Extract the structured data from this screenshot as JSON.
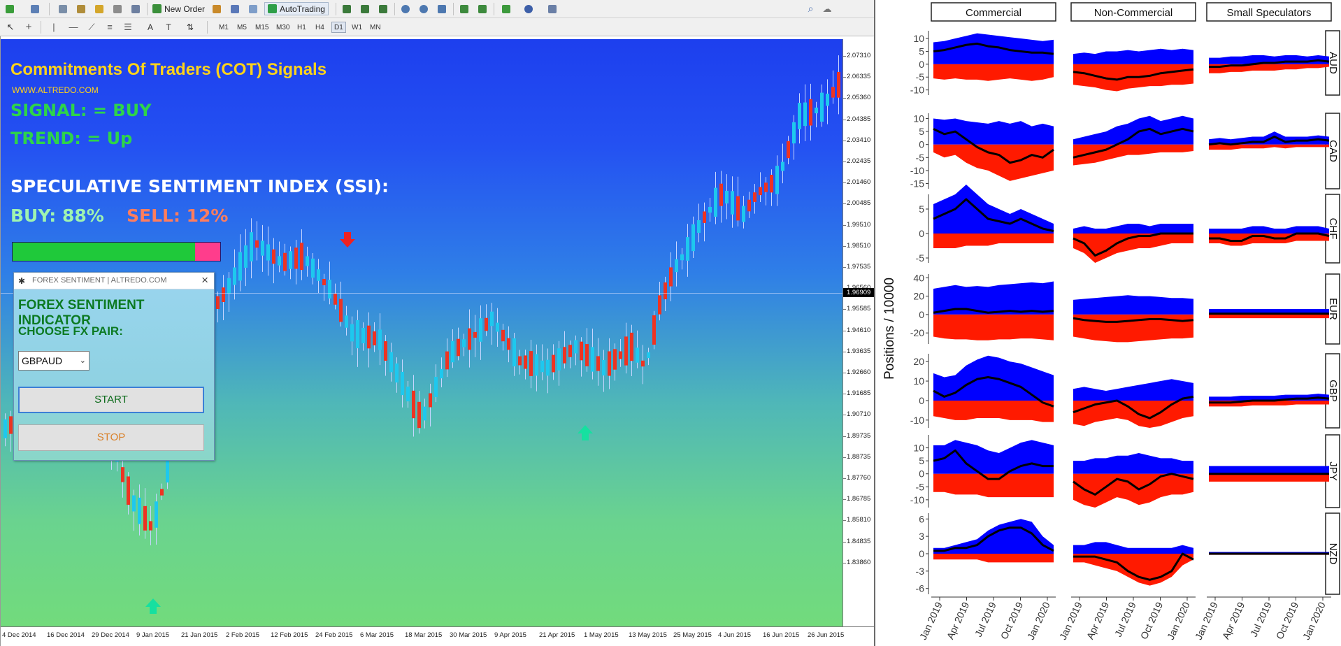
{
  "toolbar": {
    "new_order_label": "New Order",
    "autotrading_label": "AutoTrading",
    "timeframes": [
      "M1",
      "M5",
      "M15",
      "M30",
      "H1",
      "H4",
      "D1",
      "W1",
      "MN"
    ],
    "active_timeframe": "D1"
  },
  "overlay": {
    "title": "Commitments Of Traders (COT) Signals",
    "url": "WWW.ALTREDO.COM",
    "signal": "SIGNAL:  = BUY",
    "trend": "TREND: = Up",
    "ssi_title": "SPECULATIVE SENTIMENT INDEX (SSI):",
    "buy_label": "BUY: 88%",
    "sell_label": "SELL: 12%",
    "buy_pct": 88,
    "sell_pct": 12,
    "colors": {
      "title": "#ffd31a",
      "signal": "#2ed44a",
      "buy_bar": "#1fc93a",
      "sell_bar": "#ff3d8c"
    }
  },
  "dialog": {
    "title": "FOREX SENTIMENT | ALTREDO.COM",
    "heading": "FOREX SENTIMENT INDICATOR",
    "choose_label": "CHOOSE FX PAIR:",
    "pair_value": "GBPAUD",
    "start_label": "START",
    "stop_label": "STOP"
  },
  "price_axis": {
    "labels": [
      "2.07310",
      "2.06335",
      "2.05360",
      "2.04385",
      "2.03410",
      "2.02435",
      "2.01460",
      "2.00485",
      "1.99510",
      "1.98510",
      "1.97535",
      "1.96560",
      "1.95585",
      "1.94610",
      "1.93635",
      "1.92660",
      "1.91685",
      "1.90710",
      "1.89735",
      "1.88735",
      "1.87760",
      "1.86785",
      "1.85810",
      "1.84835",
      "1.83860"
    ],
    "current": "1.96909"
  },
  "time_axis": {
    "labels": [
      "4 Dec 2014",
      "16 Dec 2014",
      "29 Dec 2014",
      "9 Jan 2015",
      "21 Jan 2015",
      "2 Feb 2015",
      "12 Feb 2015",
      "24 Feb 2015",
      "6 Mar 2015",
      "18 Mar 2015",
      "30 Mar 2015",
      "9 Apr 2015",
      "21 Apr 2015",
      "1 May 2015",
      "13 May 2015",
      "25 May 2015",
      "4 Jun 2015",
      "16 Jun 2015",
      "26 Jun 2015"
    ]
  },
  "chart_data": {
    "type": "area",
    "ylabel": "Positions / 10000",
    "columns": [
      "Commercial",
      "Non-Commercial",
      "Small Speculators"
    ],
    "rows": [
      "AUD",
      "CAD",
      "CHF",
      "EUR",
      "GBP",
      "JPY",
      "NZD"
    ],
    "x_labels": [
      "Jan 2019",
      "Apr 2019",
      "Jul 2019",
      "Oct 2019",
      "Jan 2020"
    ],
    "y_ticks": {
      "AUD": [
        10,
        5,
        0,
        -5,
        -10
      ],
      "CAD": [
        10,
        5,
        0,
        -5,
        -10,
        -15
      ],
      "CHF": [
        5,
        0,
        -5
      ],
      "EUR": [
        40,
        20,
        0,
        -20
      ],
      "GBP": [
        20,
        10,
        0,
        -10
      ],
      "JPY": [
        10,
        5,
        0,
        -5,
        -10
      ],
      "NZD": [
        6,
        3,
        0,
        -3,
        -6
      ]
    },
    "ylim": {
      "AUD": [
        -12,
        13
      ],
      "CAD": [
        -17,
        12
      ],
      "CHF": [
        -6,
        8
      ],
      "EUR": [
        -32,
        44
      ],
      "GBP": [
        -14,
        24
      ],
      "JPY": [
        -13,
        15
      ],
      "NZD": [
        -7,
        7
      ]
    },
    "series_colors": {
      "long": "#0000ff",
      "short": "#ff1a00",
      "net": "#000000"
    },
    "panels": {
      "AUD": {
        "Commercial": {
          "long": [
            8.5,
            9,
            10,
            11,
            12,
            11.5,
            11,
            10.5,
            10,
            9.5,
            9,
            9.5
          ],
          "short": [
            -5.5,
            -6,
            -5.5,
            -6,
            -6,
            -6.5,
            -6,
            -5.5,
            -6,
            -6.5,
            -6,
            -5
          ],
          "net": [
            5,
            5.5,
            6.5,
            7.5,
            8,
            7,
            6.5,
            5.5,
            5,
            4.5,
            4.5,
            4
          ]
        },
        "Non-Commercial": {
          "long": [
            4,
            4.5,
            4,
            5,
            5,
            5.5,
            5,
            5.5,
            6,
            5.5,
            6,
            5.5
          ],
          "short": [
            -8,
            -8.5,
            -9,
            -10,
            -10.5,
            -9.5,
            -9,
            -8.5,
            -8.5,
            -8,
            -8,
            -7.5
          ],
          "net": [
            -3,
            -3.5,
            -4.5,
            -5.5,
            -6,
            -5,
            -5,
            -4.5,
            -3.5,
            -3,
            -2.5,
            -2
          ]
        },
        "Small Speculators": {
          "long": [
            2.5,
            2.5,
            3,
            3,
            3.5,
            3.5,
            3,
            3.5,
            3.5,
            3,
            3.5,
            3
          ],
          "short": [
            -3.5,
            -3.5,
            -3,
            -3,
            -2.5,
            -2.5,
            -2.5,
            -2,
            -2,
            -1.5,
            -1.5,
            -1
          ],
          "net": [
            -1,
            -1,
            -0.5,
            -0.5,
            0,
            0.5,
            0.5,
            1,
            1,
            1,
            1.5,
            1
          ]
        }
      },
      "CAD": {
        "Commercial": {
          "long": [
            10,
            9.5,
            10,
            9,
            8.5,
            8,
            9,
            8,
            9,
            7,
            8,
            7
          ],
          "short": [
            -3,
            -5,
            -4,
            -7,
            -9,
            -10,
            -12,
            -14,
            -13,
            -12,
            -11,
            -10
          ],
          "net": [
            6,
            4,
            5,
            2,
            -1,
            -3,
            -4,
            -7,
            -6,
            -4,
            -5,
            -2
          ]
        },
        "Non-Commercial": {
          "long": [
            2,
            3,
            4,
            5,
            7,
            8,
            10,
            11,
            9,
            10,
            11,
            10
          ],
          "short": [
            -8,
            -7.5,
            -7,
            -6,
            -5,
            -4,
            -4,
            -3.5,
            -3,
            -3,
            -3,
            -2.5
          ],
          "net": [
            -5,
            -4,
            -3,
            -2,
            0,
            2,
            5,
            6,
            4,
            5,
            6,
            5
          ]
        },
        "Small Speculators": {
          "long": [
            2,
            2.5,
            2,
            2.5,
            3,
            3,
            5,
            3,
            3,
            3,
            3.5,
            3
          ],
          "short": [
            -2,
            -2,
            -2,
            -1.5,
            -1.5,
            -1.5,
            -1,
            -1.5,
            -1,
            -1,
            -1,
            -1
          ],
          "net": [
            0,
            0.5,
            0,
            0.5,
            1,
            1,
            3,
            1,
            1.5,
            1.5,
            2,
            1.5
          ]
        }
      },
      "CHF": {
        "Commercial": {
          "long": [
            6,
            7,
            8,
            10,
            8,
            6,
            5,
            4,
            5,
            4,
            3,
            2
          ],
          "short": [
            -3,
            -3,
            -3,
            -2.5,
            -2.5,
            -2.5,
            -2,
            -2,
            -2,
            -2,
            -2,
            -2
          ],
          "net": [
            3,
            4,
            5,
            7,
            5,
            3,
            2.5,
            2,
            3,
            2,
            1,
            0.5
          ]
        },
        "Non-Commercial": {
          "long": [
            1,
            1.5,
            1,
            1,
            1.5,
            2,
            2,
            1.5,
            2,
            2,
            2,
            2
          ],
          "short": [
            -3,
            -4,
            -6,
            -5,
            -4,
            -3.5,
            -3,
            -3,
            -2.5,
            -2,
            -2,
            -2
          ],
          "net": [
            -1,
            -2,
            -4.5,
            -3.5,
            -2,
            -1,
            -0.5,
            -0.5,
            0,
            0,
            0,
            0
          ]
        },
        "Small Speculators": {
          "long": [
            1,
            1,
            1,
            1,
            1.5,
            1.5,
            1,
            1,
            1.5,
            1.5,
            1.5,
            1
          ],
          "short": [
            -2,
            -2,
            -2.5,
            -2.5,
            -2,
            -2,
            -2,
            -2,
            -1.5,
            -1.5,
            -1.5,
            -1.5
          ],
          "net": [
            -1,
            -1,
            -1.5,
            -1.5,
            -0.5,
            -0.5,
            -1,
            -1,
            0,
            0,
            0,
            -0.5
          ]
        }
      },
      "EUR": {
        "Commercial": {
          "long": [
            28,
            30,
            32,
            30,
            31,
            30,
            32,
            33,
            34,
            35,
            34,
            36
          ],
          "short": [
            -24,
            -26,
            -27,
            -27,
            -28,
            -28,
            -27,
            -27,
            -26,
            -26,
            -27,
            -28
          ],
          "net": [
            2,
            4,
            6,
            6,
            4,
            2,
            3,
            4,
            3,
            4,
            3,
            4
          ]
        },
        "Non-Commercial": {
          "long": [
            16,
            17,
            18,
            19,
            20,
            21,
            20,
            20,
            19,
            18,
            18,
            17
          ],
          "short": [
            -24,
            -26,
            -28,
            -29,
            -30,
            -30,
            -29,
            -28,
            -27,
            -26,
            -26,
            -25
          ],
          "net": [
            -4,
            -6,
            -7,
            -8,
            -8,
            -7,
            -6,
            -5,
            -5,
            -6,
            -7,
            -6
          ]
        },
        "Small Speculators": {
          "long": [
            6,
            6,
            6,
            6,
            6,
            6,
            6,
            6,
            6,
            6,
            6,
            6
          ],
          "short": [
            -4,
            -4,
            -4,
            -4,
            -4,
            -4,
            -4,
            -4,
            -4,
            -4,
            -4,
            -4
          ],
          "net": [
            1,
            1,
            1,
            1,
            1,
            1,
            1,
            1,
            1,
            1,
            1,
            1
          ]
        }
      },
      "GBP": {
        "Commercial": {
          "long": [
            14,
            12,
            13,
            18,
            21,
            23,
            22,
            20,
            19,
            17,
            15,
            13
          ],
          "short": [
            -8,
            -9,
            -10,
            -10,
            -9,
            -9,
            -9,
            -10,
            -10,
            -10,
            -11,
            -11
          ],
          "net": [
            5,
            2,
            4,
            8,
            11,
            12,
            11,
            9,
            7,
            3,
            -1,
            -3
          ]
        },
        "Non-Commercial": {
          "long": [
            6,
            7,
            6,
            5,
            6,
            7,
            8,
            9,
            10,
            11,
            10,
            9
          ],
          "short": [
            -12,
            -13,
            -11,
            -10,
            -9,
            -10,
            -13,
            -14,
            -13,
            -11,
            -9,
            -8
          ],
          "net": [
            -6,
            -4,
            -2,
            -1,
            0,
            -3,
            -7,
            -9,
            -6,
            -2,
            1,
            2
          ]
        },
        "Small Speculators": {
          "long": [
            2,
            2,
            2,
            2.5,
            2.5,
            2.5,
            2.5,
            3,
            3,
            3,
            3.5,
            3
          ],
          "short": [
            -3,
            -3,
            -3,
            -3,
            -2.5,
            -2.5,
            -2.5,
            -2.5,
            -2,
            -2,
            -2,
            -2
          ],
          "net": [
            -1,
            -1,
            -1,
            -0.5,
            0,
            0,
            0,
            0.5,
            1,
            1,
            1.5,
            1
          ]
        }
      },
      "JPY": {
        "Commercial": {
          "long": [
            11,
            11,
            13,
            12,
            11,
            9,
            8,
            10,
            12,
            13,
            12,
            11
          ],
          "short": [
            -7,
            -7,
            -8,
            -8,
            -8,
            -9,
            -9,
            -9,
            -9,
            -9,
            -9,
            -9
          ],
          "net": [
            5,
            6,
            9,
            4,
            1,
            -2,
            -2,
            1,
            3,
            4,
            3,
            3
          ]
        },
        "Non-Commercial": {
          "long": [
            5,
            5,
            6,
            6,
            7,
            7,
            8,
            7,
            6,
            6,
            5,
            5
          ],
          "short": [
            -10,
            -12,
            -13,
            -11,
            -9,
            -10,
            -12,
            -11,
            -9,
            -8,
            -8,
            -7
          ],
          "net": [
            -3,
            -6,
            -8,
            -5,
            -2,
            -3,
            -6,
            -4,
            -1,
            0,
            -1,
            -2
          ]
        },
        "Small Speculators": {
          "long": [
            3,
            3,
            3,
            3,
            3,
            3,
            3,
            3,
            3,
            3,
            3,
            3
          ],
          "short": [
            -3,
            -3,
            -3,
            -3,
            -3,
            -3,
            -3,
            -3,
            -3,
            -3,
            -3,
            -3
          ],
          "net": [
            0,
            0,
            0,
            0,
            0,
            0,
            0,
            0,
            0,
            0,
            0,
            0
          ]
        }
      },
      "NZD": {
        "Commercial": {
          "long": [
            1,
            1,
            1.5,
            2,
            2.5,
            4,
            5,
            5.5,
            6,
            5.5,
            3,
            1.5
          ],
          "short": [
            -1,
            -1,
            -1,
            -1,
            -1,
            -1.5,
            -1.5,
            -1.5,
            -1.5,
            -1.5,
            -1.5,
            -1.5
          ],
          "net": [
            0.5,
            0.5,
            1,
            1,
            1.5,
            3,
            4,
            4.5,
            4.5,
            3.5,
            1.5,
            0.5
          ]
        },
        "Non-Commercial": {
          "long": [
            1.5,
            1.5,
            2,
            2,
            1.5,
            1,
            1,
            1,
            1,
            1,
            1.5,
            1
          ],
          "short": [
            -1.5,
            -1.5,
            -2,
            -2.5,
            -3,
            -4,
            -5,
            -5.5,
            -5,
            -4,
            -2,
            -1
          ],
          "net": [
            -0.5,
            -0.5,
            -0.5,
            -1,
            -1.5,
            -3,
            -4,
            -4.5,
            -4,
            -3,
            0,
            -1
          ]
        },
        "Small Speculators": {
          "long": [
            0.3,
            0.3,
            0.3,
            0.3,
            0.3,
            0.3,
            0.3,
            0.3,
            0.3,
            0.3,
            0.3,
            0.3
          ],
          "short": [
            -0.2,
            -0.2,
            -0.2,
            -0.2,
            -0.2,
            -0.2,
            -0.2,
            -0.2,
            -0.2,
            -0.2,
            -0.2,
            -0.2
          ],
          "net": [
            0,
            0,
            0,
            0,
            0,
            0,
            0,
            0,
            0,
            0,
            0,
            0
          ]
        }
      }
    }
  }
}
